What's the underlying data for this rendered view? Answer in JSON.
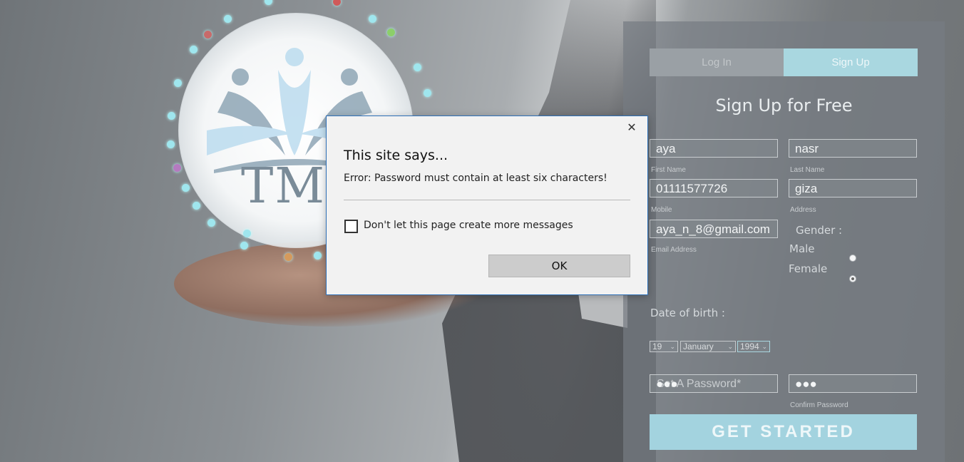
{
  "logo": {
    "text": "TMS"
  },
  "signup_panel": {
    "tabs": [
      {
        "label": "Log In",
        "active": false
      },
      {
        "label": "Sign Up",
        "active": true
      }
    ],
    "title": "Sign Up for Free",
    "first_name": {
      "value": "aya",
      "hint": "First Name"
    },
    "last_name": {
      "value": "nasr",
      "hint": "Last Name"
    },
    "mobile": {
      "value": "01111577726",
      "hint": "Mobile"
    },
    "address": {
      "value": "giza",
      "hint": "Address"
    },
    "email": {
      "value": "aya_n_8@gmail.com",
      "hint": "Email Address"
    },
    "gender": {
      "label": "Gender :",
      "options": [
        "Male",
        "Female"
      ],
      "selected": "Female"
    },
    "dob": {
      "label": "Date of birth :",
      "day": "19",
      "month": "January",
      "year": "1994"
    },
    "password": {
      "value": "●●●",
      "placeholder": "Set A Password*"
    },
    "confirm_password": {
      "value": "●●●",
      "hint": "Confirm Password"
    },
    "submit_label": "GET STARTED"
  },
  "dialog": {
    "title": "This site says...",
    "message": "Error: Password must contain at least six characters!",
    "checkbox_label": "Don't let this page create more messages",
    "checkbox_checked": false,
    "ok_label": "OK",
    "close_glyph": "✕"
  },
  "colors": {
    "accent": "#a9d7e0",
    "dialog_border": "#2d6fb7"
  }
}
